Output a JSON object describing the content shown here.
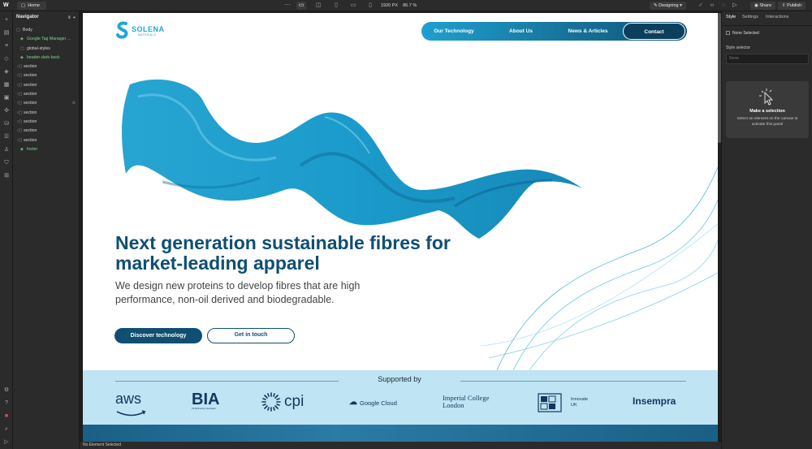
{
  "topbar": {
    "logo": "W",
    "home_label": "Home",
    "viewport_px": "1920 PX",
    "zoom": "86.7 %",
    "mode_label": "Designing",
    "share_label": "Share",
    "publish_label": "Publish"
  },
  "navigator": {
    "title": "Navigator",
    "items": [
      {
        "label": "Body"
      },
      {
        "label": "Google Tag Manager ..."
      },
      {
        "label": "global-styles"
      },
      {
        "label": "header-dark-back"
      },
      {
        "label": "section"
      },
      {
        "label": "section"
      },
      {
        "label": "section"
      },
      {
        "label": "section"
      },
      {
        "label": "section"
      },
      {
        "label": "section"
      },
      {
        "label": "section"
      },
      {
        "label": "section"
      },
      {
        "label": "section"
      },
      {
        "label": "footer"
      }
    ]
  },
  "site": {
    "logo_word": "SOLENA",
    "logo_sub": "MATERIALS",
    "menu": [
      "Our Technology",
      "About Us",
      "News & Articles",
      "Contact"
    ],
    "hero_title": "Next generation sustainable fibres for market-leading apparel",
    "hero_sub": "We design new proteins to develop fibres that are high performance, non-oil derived and biodegradable.",
    "btn_primary": "Discover technology",
    "btn_secondary": "Get in touch",
    "supported_title": "Supported by",
    "partners": {
      "aws": "aws",
      "bia": "BIA",
      "bia_sub": "UK BioIndustry Association",
      "cpi": "cpi",
      "google": "Google Cloud",
      "imperial_1": "Imperial College",
      "imperial_2": "London",
      "innovate_1": "Innovate",
      "innovate_2": "UK",
      "insempra": "Insempra"
    }
  },
  "status_bar": {
    "text": "No Element Selected"
  },
  "right_panel": {
    "tabs": [
      "Style",
      "Settings",
      "Interactions"
    ],
    "none_selected": "None Selected",
    "style_selector_label": "Style selector",
    "style_selector_placeholder": "None",
    "card_title": "Make a selection",
    "card_text": "Select an element on the canvas to activate this panel"
  }
}
